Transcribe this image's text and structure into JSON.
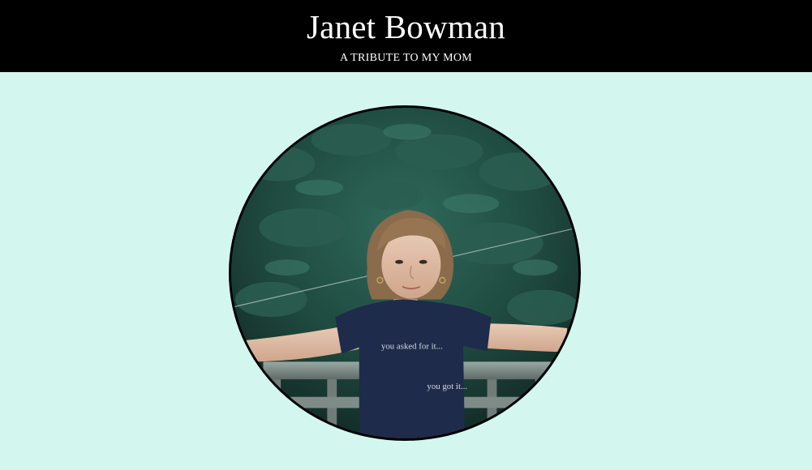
{
  "header": {
    "title": "Janet Bowman",
    "subtitle": "A TRIBUTE TO MY MOM"
  },
  "portrait": {
    "shirt_text_line1": "you asked for it...",
    "shirt_text_line2": "you got it...",
    "colors": {
      "page_background": "#d3f7ef",
      "header_background": "#000000",
      "header_text": "#ffffff",
      "portrait_border": "#000000",
      "foliage": "#1f4a40",
      "shirt": "#1e2b4a"
    }
  }
}
